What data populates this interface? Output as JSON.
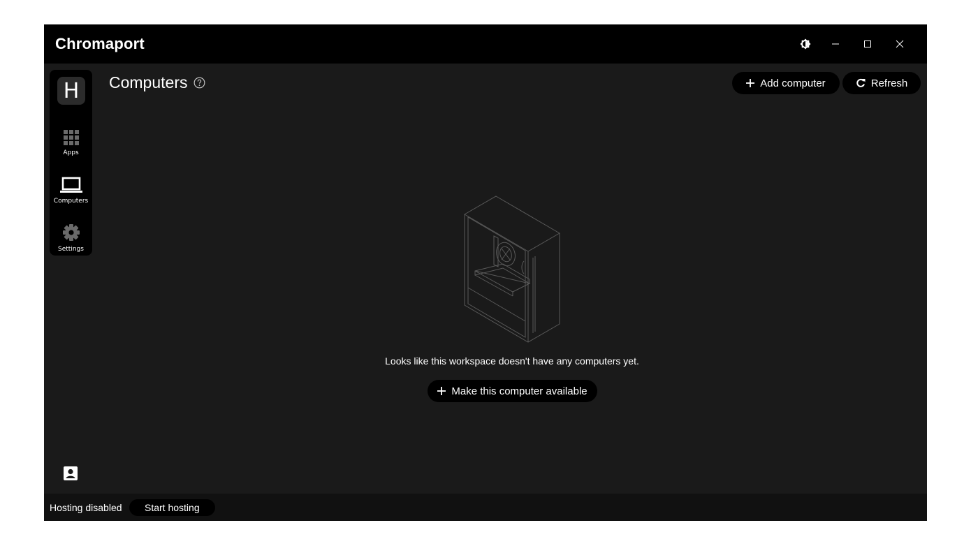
{
  "app": {
    "title": "Chromaport"
  },
  "titlebar": {
    "icons": [
      "theme-toggle-icon",
      "minimize-icon",
      "maximize-icon",
      "close-icon"
    ]
  },
  "sidebar": {
    "workspace_initial": "H",
    "items": [
      {
        "id": "apps",
        "label": "Apps",
        "icon": "grid-icon"
      },
      {
        "id": "computers",
        "label": "Computers",
        "icon": "laptop-icon",
        "active": true
      },
      {
        "id": "settings",
        "label": "Settings",
        "icon": "gear-icon"
      }
    ]
  },
  "header": {
    "title": "Computers",
    "add_label": "Add computer",
    "refresh_label": "Refresh"
  },
  "empty_state": {
    "message": "Looks like this workspace doesn't have any computers yet.",
    "cta_label": "Make this computer available"
  },
  "statusbar": {
    "hosting_status": "Hosting disabled",
    "start_label": "Start hosting"
  },
  "colors": {
    "window_bg": "#1a1a1a",
    "titlebar_bg": "#000000",
    "button_bg": "#000000",
    "statusbar_bg": "#111111",
    "illustration_stroke": "#5a5a5a"
  }
}
